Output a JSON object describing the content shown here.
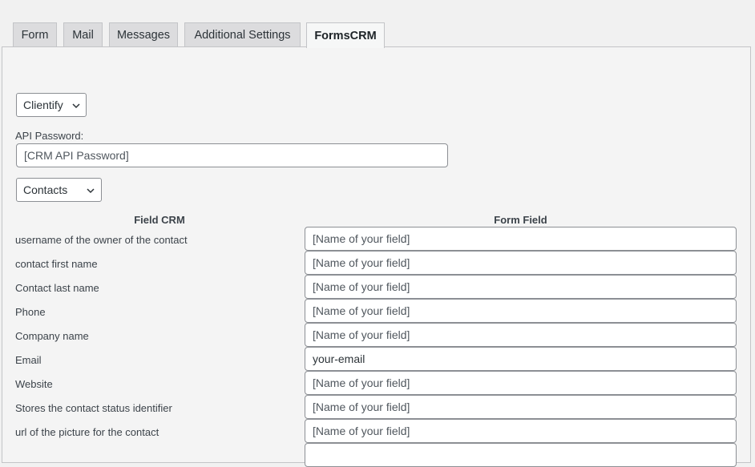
{
  "tabs": [
    {
      "label": "Form"
    },
    {
      "label": "Mail"
    },
    {
      "label": "Messages"
    },
    {
      "label": "Additional Settings"
    },
    {
      "label": "FormsCRM",
      "active": true
    }
  ],
  "crm_select": {
    "value": "Clientify"
  },
  "api_password": {
    "label": "API Password:",
    "value": "[CRM API Password]"
  },
  "module_select": {
    "value": "Contacts"
  },
  "table": {
    "headers": {
      "crm": "Field CRM",
      "form": "Form Field"
    },
    "rows": [
      {
        "label": "username of the owner of the contact",
        "value": "[Name of your field]"
      },
      {
        "label": "contact first name",
        "value": "[Name of your field]"
      },
      {
        "label": "Contact last name",
        "value": "[Name of your field]"
      },
      {
        "label": "Phone",
        "value": "[Name of your field]"
      },
      {
        "label": "Company name",
        "value": "[Name of your field]"
      },
      {
        "label": "Email",
        "value": "your-email"
      },
      {
        "label": "Website",
        "value": "[Name of your field]"
      },
      {
        "label": "Stores the contact status identifier",
        "value": "[Name of your field]"
      },
      {
        "label": "url of the picture for the contact",
        "value": "[Name of your field]"
      }
    ]
  },
  "icons": {
    "dropdown": "chevron-down-icon"
  }
}
